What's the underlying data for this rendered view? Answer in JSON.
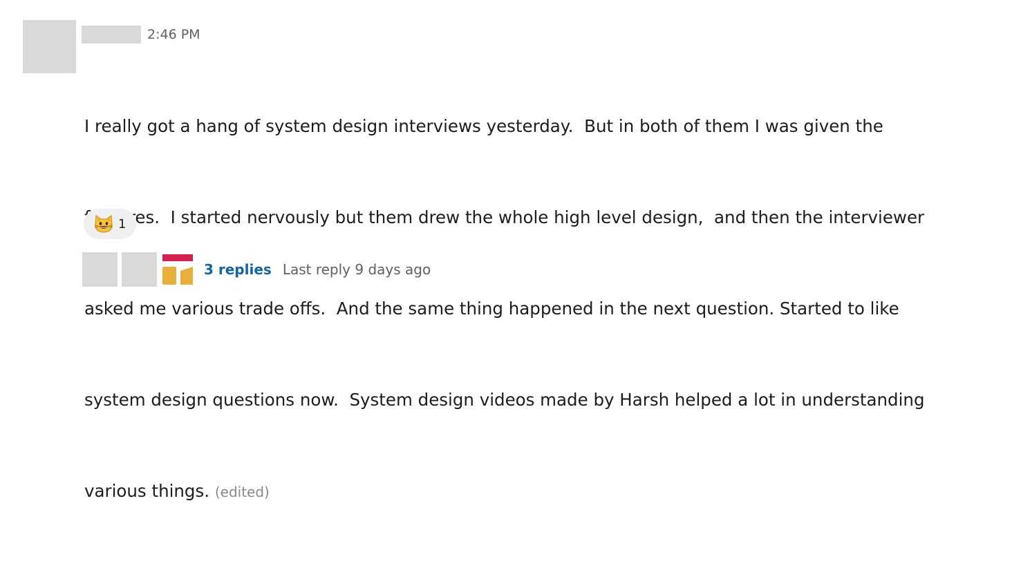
{
  "message": {
    "timestamp": "2:46 PM",
    "body_lines": [
      "I really got a hang of system design interviews yesterday.  But in both of them I was given the",
      "features.  I started nervously but them drew the whole high level design,  and then the interviewer",
      "asked me various trade offs.  And the same thing happened in the next question. Started to like",
      "system design questions now.  System design videos made by Harsh helped a lot in understanding",
      "various things."
    ],
    "edited_label": "(edited)",
    "reaction": {
      "emoji": "smiley-cat-icon",
      "count": "1"
    },
    "thread": {
      "replies_label": "3 replies",
      "last_reply": "Last reply 9 days ago"
    }
  },
  "colors": {
    "link": "#1264a3",
    "muted": "#616061",
    "placeholder": "#d9d9d9"
  }
}
